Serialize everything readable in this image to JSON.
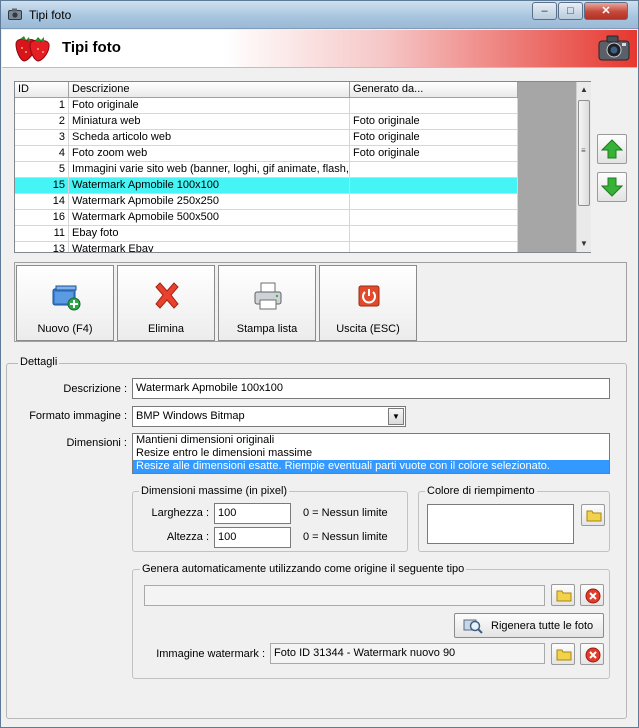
{
  "window": {
    "title": "Tipi foto",
    "minimize_glyph": "–",
    "maximize_glyph": "□",
    "close_glyph": "✕"
  },
  "header": {
    "title": "Tipi foto",
    "logo_icon": "strawberry-icon",
    "camera_icon": "camera-icon",
    "gradient_color": "#e6372f"
  },
  "table": {
    "columns": [
      "ID",
      "Descrizione",
      "Generato da..."
    ],
    "selected_color": "#45f4f4",
    "rows": [
      {
        "id": "1",
        "descrizione": "Foto originale",
        "generato": ""
      },
      {
        "id": "2",
        "descrizione": "Miniatura web",
        "generato": "Foto originale"
      },
      {
        "id": "3",
        "descrizione": "Scheda articolo web",
        "generato": "Foto originale"
      },
      {
        "id": "4",
        "descrizione": "Foto zoom web",
        "generato": "Foto originale"
      },
      {
        "id": "5",
        "descrizione": "Immagini varie sito web (banner, loghi, gif animate, flash, ...",
        "generato": ""
      },
      {
        "id": "15",
        "descrizione": "Watermark Apmobile 100x100",
        "generato": ""
      },
      {
        "id": "14",
        "descrizione": "Watermark Apmobile 250x250",
        "generato": ""
      },
      {
        "id": "16",
        "descrizione": "Watermark Apmobile 500x500",
        "generato": ""
      },
      {
        "id": "11",
        "descrizione": "Ebay foto",
        "generato": ""
      },
      {
        "id": "13",
        "descrizione": "Watermark Ebay",
        "generato": ""
      }
    ],
    "selected_row_index": 5,
    "scroll_up_glyph": "▲",
    "scroll_down_glyph": "▼"
  },
  "side_buttons": {
    "up_icon": "arrow-up-icon",
    "down_icon": "arrow-down-icon",
    "arrow_color": "#2aa02a"
  },
  "actions": {
    "new_label": "Nuovo (F4)",
    "delete_label": "Elimina",
    "print_label": "Stampa lista",
    "exit_label": "Uscita (ESC)"
  },
  "details": {
    "legend": "Dettagli",
    "descrizione_label": "Descrizione :",
    "descrizione_value": "Watermark Apmobile 100x100",
    "formato_label": "Formato immagine :",
    "formato_value": "BMP Windows Bitmap",
    "dimensioni_label": "Dimensioni :",
    "dimensioni_options": [
      "Mantieni dimensioni originali",
      "Resize entro le dimensioni massime",
      "Resize alle dimensioni esatte. Riempie eventuali parti vuote con il colore selezionato."
    ],
    "dimensioni_selected_index": 2,
    "max_group_legend": "Dimensioni massime (in pixel)",
    "larghezza_label": "Larghezza :",
    "larghezza_value": "100",
    "altezza_label": "Altezza :",
    "altezza_value": "100",
    "no_limit_hint": "0 = Nessun limite",
    "colore_legend": "Colore di riempimento",
    "genera_legend": "Genera automaticamente utilizzando come origine il seguente tipo",
    "origine_value": "",
    "regenerate_label": "Rigenera tutte le foto",
    "watermark_label": "Immagine watermark :",
    "watermark_value": "Foto ID 31344 - Watermark nuovo 90"
  }
}
